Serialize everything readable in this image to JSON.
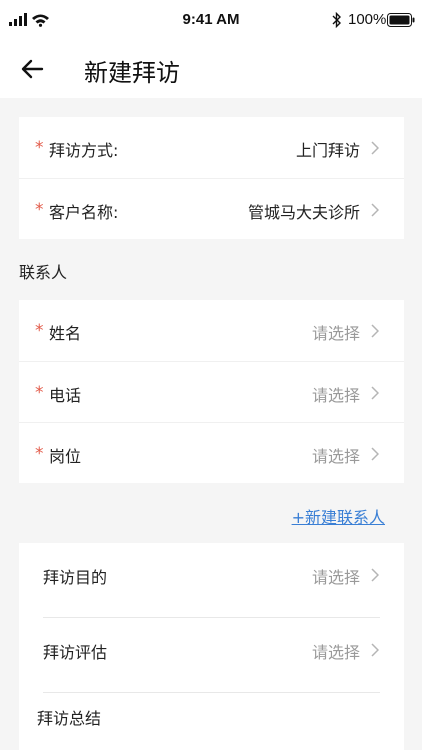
{
  "status_bar": {
    "time": "9:41 AM",
    "battery": "100%"
  },
  "nav": {
    "title": "新建拜访"
  },
  "visit_card": {
    "rows": [
      {
        "label": "拜访方式:",
        "value": "上门拜访",
        "required": "*"
      },
      {
        "label": "客户名称:",
        "value": "管城马大夫诊所",
        "required": "*"
      }
    ]
  },
  "contacts": {
    "section_label": "联系人",
    "rows": [
      {
        "label": "姓名",
        "value": "请选择",
        "required": "*"
      },
      {
        "label": "电话",
        "value": "请选择",
        "required": "*"
      },
      {
        "label": "岗位",
        "value": "请选择",
        "required": "*"
      }
    ],
    "add_link": "+新建联系人"
  },
  "details": {
    "rows": [
      {
        "label": "拜访目的",
        "value": "请选择"
      },
      {
        "label": "拜访评估",
        "value": "请选择"
      }
    ],
    "summary_label": "拜访总结"
  }
}
